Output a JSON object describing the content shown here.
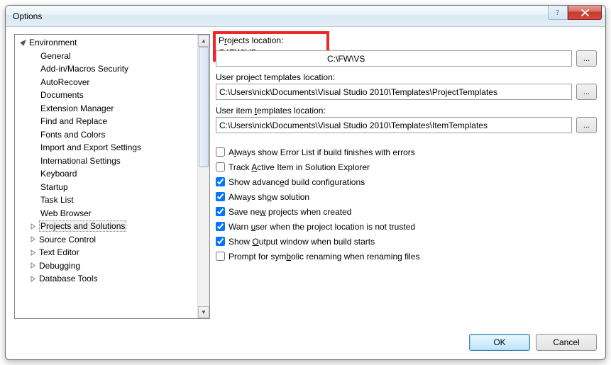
{
  "title": "Options",
  "tree": {
    "environment": {
      "label": "Environment",
      "children": [
        "General",
        "Add-in/Macros Security",
        "AutoRecover",
        "Documents",
        "Extension Manager",
        "Find and Replace",
        "Fonts and Colors",
        "Import and Export Settings",
        "International Settings",
        "Keyboard",
        "Startup",
        "Task List",
        "Web Browser"
      ]
    },
    "projects_and_solutions": "Projects and Solutions",
    "source_control": "Source Control",
    "text_editor": "Text Editor",
    "debugging": "Debugging",
    "database_tools": "Database Tools"
  },
  "fields": {
    "projects_location": {
      "label_pre": "P",
      "label_u": "r",
      "label_post": "ojects location:",
      "value": "C:\\FW\\VS"
    },
    "user_project_templates": {
      "label_pre": "User pro",
      "label_u": "j",
      "label_post": "ect templates location:",
      "value": "C:\\Users\\nick\\Documents\\Visual Studio 2010\\Templates\\ProjectTemplates"
    },
    "user_item_templates": {
      "label_pre": "User item ",
      "label_u": "t",
      "label_post": "emplates location:",
      "value": "C:\\Users\\nick\\Documents\\Visual Studio 2010\\Templates\\ItemTemplates"
    },
    "browse_label": "..."
  },
  "checkboxes": [
    {
      "checked": false,
      "pre": "A",
      "u": "l",
      "post": "ways show Error List if build finishes with errors"
    },
    {
      "checked": false,
      "pre": "Track ",
      "u": "A",
      "post": "ctive Item in Solution Explorer"
    },
    {
      "checked": true,
      "pre": "Show advanc",
      "u": "e",
      "post": "d build configurations"
    },
    {
      "checked": true,
      "pre": "Always sh",
      "u": "o",
      "post": "w solution"
    },
    {
      "checked": true,
      "pre": "Save ne",
      "u": "w",
      "post": " projects when created"
    },
    {
      "checked": true,
      "pre": "Warn ",
      "u": "u",
      "post": "ser when the project location is not trusted"
    },
    {
      "checked": true,
      "pre": "Show ",
      "u": "O",
      "post": "utput window when build starts"
    },
    {
      "checked": false,
      "pre": "Prompt for sym",
      "u": "b",
      "post": "olic renaming when renaming files"
    }
  ],
  "buttons": {
    "ok": "OK",
    "cancel": "Cancel"
  }
}
